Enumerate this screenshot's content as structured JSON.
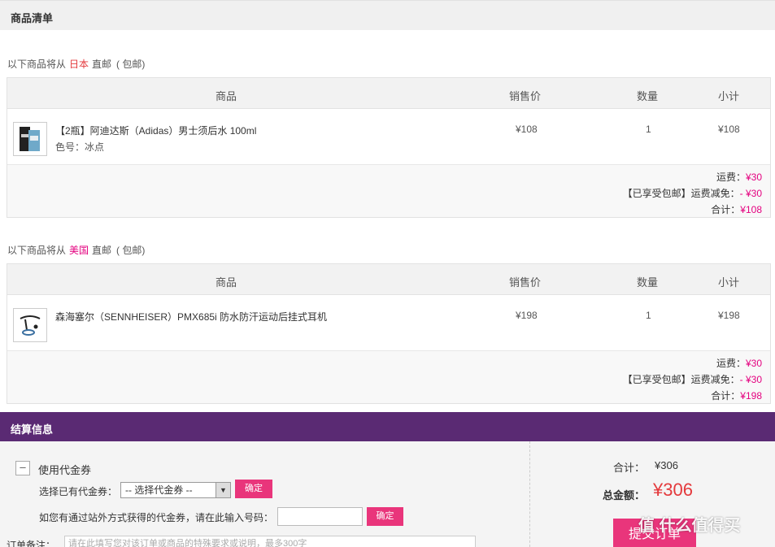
{
  "product_list": {
    "title": "商品清单"
  },
  "columns": {
    "product": "商品",
    "price": "销售价",
    "qty": "数量",
    "subtotal": "小计"
  },
  "orders": [
    {
      "origin_prefix": "以下商品将从",
      "country": "日本",
      "origin_suffix": "直邮",
      "shipping_note": "( 包邮)",
      "item": {
        "name": "【2瓶】阿迪达斯（Adidas）男士须后水 100ml",
        "attr": "色号：冰点",
        "price": "¥108",
        "qty": "1",
        "subtotal": "¥108",
        "thumb_icon": "aftershave-bottle-icon"
      },
      "summary": {
        "shipping_label": "运费：",
        "shipping_value": "¥30",
        "discount_label": "【已享受包邮】运费减免：",
        "discount_value": "- ¥30",
        "total_label": "合计：",
        "total_value": "¥108"
      }
    },
    {
      "origin_prefix": "以下商品将从",
      "country": "美国",
      "origin_suffix": "直邮",
      "shipping_note": "( 包邮)",
      "item": {
        "name": "森海塞尔（SENNHEISER）PMX685i 防水防汗运动后挂式耳机",
        "attr": "",
        "price": "¥198",
        "qty": "1",
        "subtotal": "¥198",
        "thumb_icon": "headphones-icon"
      },
      "summary": {
        "shipping_label": "运费：",
        "shipping_value": "¥30",
        "discount_label": "【已享受包邮】运费减免：",
        "discount_value": "- ¥30",
        "total_label": "合计：",
        "total_value": "¥198"
      }
    }
  ],
  "checkout": {
    "title": "结算信息",
    "toggle_symbol": "–",
    "coupon_title": "使用代金券",
    "select_label": "选择已有代金券：",
    "select_value": "-- 选择代金券 --",
    "confirm_label": "确定",
    "code_label": "如您有通过站外方式获得的代金券，请在此输入号码：",
    "code_value": "",
    "remark_label": "订单备注：",
    "remark_placeholder": "请在此填写您对该订单或商品的特殊要求或说明，最多300字",
    "sum_label": "合计：",
    "sum_value": "¥306",
    "total_label": "总金额：",
    "total_value": "¥306",
    "submit_label": "提交订单"
  },
  "watermark": "值 什么值得买",
  "colors": {
    "accent_pink": "#e9357b",
    "header_purple": "#5a2a73",
    "price_red": "#e4393c"
  }
}
